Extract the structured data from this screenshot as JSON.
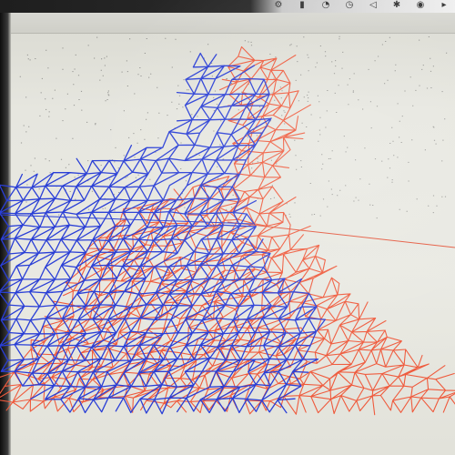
{
  "scene": {
    "description_free": true
  },
  "menubar": {
    "icons": [
      "gear-icon",
      "battery-icon",
      "wifi-icon",
      "clock-icon",
      "volume-icon",
      "bluetooth-icon",
      "user-icon",
      "more-icon"
    ]
  },
  "colors": {
    "blue_mesh": "#2a3fd6",
    "red_mesh": "#ef5a3c",
    "red_line": "#e4553a",
    "background": "#e7e7e0"
  }
}
